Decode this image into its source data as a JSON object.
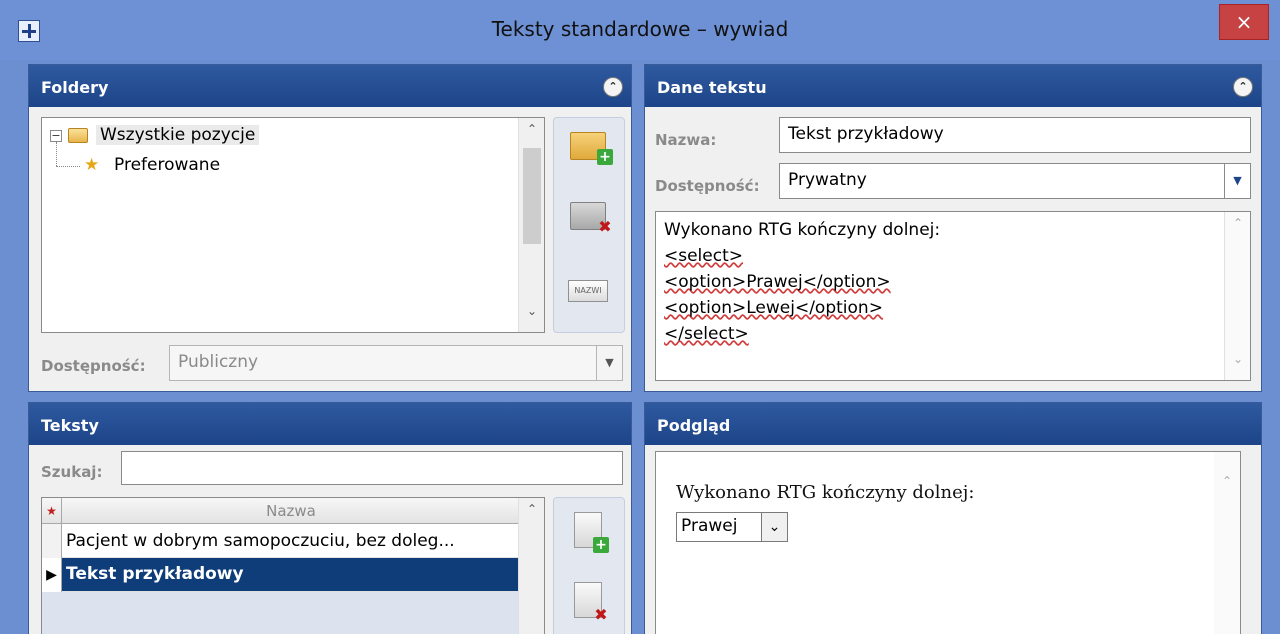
{
  "window": {
    "title": "Teksty standardowe – wywiad",
    "close_symbol": "×",
    "app_icon": "plus-icon",
    "accent_color": "#1d4488",
    "background_color": "#6b8fd0"
  },
  "folders_panel": {
    "title": "Foldery",
    "collapse_symbol": "⌃",
    "tree": [
      {
        "label": "Wszystkie pozycje",
        "icon": "folder-icon",
        "expanded": true,
        "expander_symbol": "−"
      },
      {
        "label": "Preferowane",
        "icon": "star-icon"
      }
    ],
    "toolbar": [
      {
        "name": "add-folder",
        "icon": "folder-add-icon"
      },
      {
        "name": "delete-folder",
        "icon": "folder-delete-icon"
      },
      {
        "name": "rename-folder",
        "icon": "rename-icon",
        "icon_text": "NAZWI"
      }
    ],
    "availability_label": "Dostępność:",
    "availability_value": "Publiczny"
  },
  "text_data_panel": {
    "title": "Dane tekstu",
    "collapse_symbol": "⌃",
    "name_label": "Nazwa:",
    "name_value": "Tekst przykładowy",
    "availability_label": "Dostępność:",
    "availability_value": "Prywatny",
    "content_lines": [
      "Wykonano RTG kończyny dolnej:",
      "<select>",
      "<option>Prawej</option>",
      "<option>Lewej</option>",
      "</select>"
    ]
  },
  "texts_panel": {
    "title": "Teksty",
    "search_label": "Szukaj:",
    "search_value": "",
    "grid": {
      "star_header": "★",
      "column_header": "Nazwa",
      "rows": [
        {
          "label": "Pacjent w dobrym samopoczuciu, bez doleg...",
          "selected": false
        },
        {
          "label": "Tekst przykładowy",
          "selected": true,
          "indicator": "▶"
        }
      ]
    },
    "toolbar": [
      {
        "name": "add-text",
        "icon": "document-add-icon"
      },
      {
        "name": "delete-text",
        "icon": "document-delete-icon"
      }
    ]
  },
  "preview_panel": {
    "title": "Podgląd",
    "text": "Wykonano RTG kończyny dolnej:",
    "select_value": "Prawej"
  }
}
